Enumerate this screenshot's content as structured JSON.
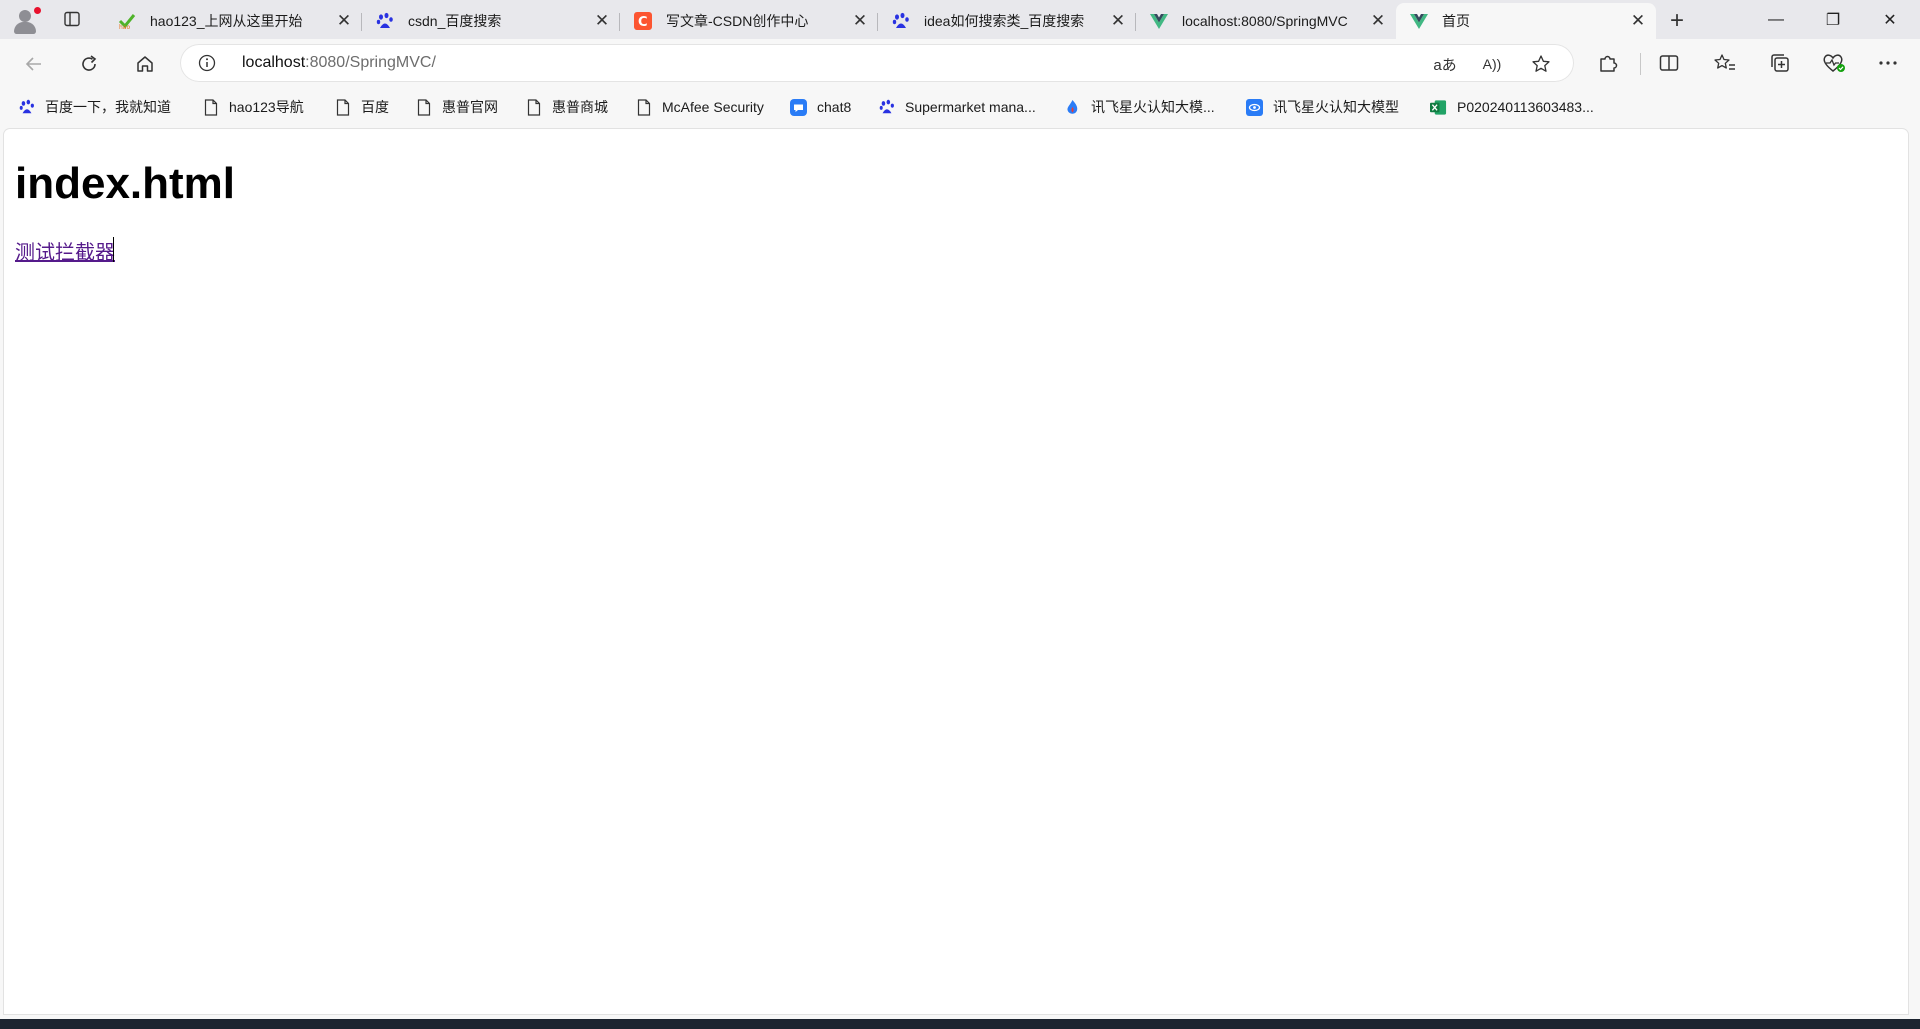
{
  "tabs": [
    {
      "title": "hao123_上网从这里开始",
      "icon": "hao123-favicon"
    },
    {
      "title": "csdn_百度搜索",
      "icon": "baidu-paw-favicon"
    },
    {
      "title": "写文章-CSDN创作中心",
      "icon": "csdn-c-favicon"
    },
    {
      "title": "idea如何搜索类_百度搜索",
      "icon": "baidu-paw-favicon"
    },
    {
      "title": "localhost:8080/SpringMVC",
      "icon": "vue-favicon"
    },
    {
      "title": "首页",
      "icon": "vue-favicon",
      "active": true
    }
  ],
  "tab_close_glyph": "✕",
  "new_tab_glyph": "+",
  "window_controls": {
    "minimize": "—",
    "restore": "❐",
    "close": "✕"
  },
  "address": {
    "host": "localhost",
    "rest": ":8080/SpringMVC/"
  },
  "address_icons": {
    "translate": "aあ",
    "read_aloud": "A))"
  },
  "bookmarks": [
    {
      "label": "百度一下，我就知道",
      "icon": "baidu-paw-icon"
    },
    {
      "label": "hao123导航",
      "icon": "page-icon"
    },
    {
      "label": "百度",
      "icon": "page-icon"
    },
    {
      "label": "惠普官网",
      "icon": "page-icon"
    },
    {
      "label": "惠普商城",
      "icon": "page-icon"
    },
    {
      "label": "McAfee Security",
      "icon": "page-icon"
    },
    {
      "label": "chat8",
      "icon": "chat-bubble-icon"
    },
    {
      "label": "Supermarket mana...",
      "icon": "baidu-paw-icon"
    },
    {
      "label": "讯飞星火认知大模...",
      "icon": "spark-icon"
    },
    {
      "label": "讯飞星火认知大模型",
      "icon": "spark-box-icon"
    },
    {
      "label": "P020240113603483...",
      "icon": "excel-icon"
    }
  ],
  "page": {
    "heading": "index.html",
    "link": "测试拦截器"
  },
  "colors": {
    "tab_strip": "#e8e8ec",
    "toolbar": "#f7f7f7",
    "visited_link": "#551a8b",
    "baidu_blue": "#2932e1",
    "csdn_red": "#fc5531",
    "vue_green": "#41b883",
    "excel_green": "#1d6f42"
  }
}
